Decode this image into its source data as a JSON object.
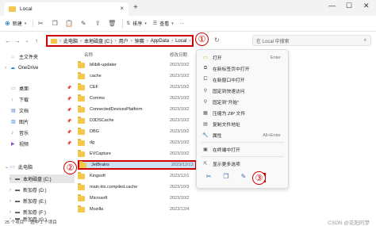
{
  "window": {
    "tab_title": "Local",
    "add_tab": "+",
    "close_tab": "×"
  },
  "toolbar": {
    "new_label": "新建",
    "sort_label": "排序",
    "view_label": "查看",
    "more_label": "···"
  },
  "address": {
    "crumbs": [
      "此电脑",
      "本地磁盘 (C:)",
      "用户",
      "钟赛",
      "AppData",
      "Local"
    ],
    "search_placeholder": "在 Local 中搜索"
  },
  "sidebar": {
    "items": [
      {
        "label": "主文件夹",
        "icon": "home-icon",
        "pinned": false
      },
      {
        "label": "OneDrive",
        "icon": "cloud-icon",
        "pinned": false
      },
      {
        "label": "桌面",
        "icon": "desktop-icon",
        "pinned": true
      },
      {
        "label": "下载",
        "icon": "download-icon",
        "pinned": true
      },
      {
        "label": "文档",
        "icon": "document-icon",
        "pinned": true
      },
      {
        "label": "图片",
        "icon": "picture-icon",
        "pinned": true
      },
      {
        "label": "音乐",
        "icon": "music-icon",
        "pinned": true
      },
      {
        "label": "视频",
        "icon": "video-icon",
        "pinned": true
      },
      {
        "label": "此电脑",
        "icon": "computer-icon",
        "pinned": false
      },
      {
        "label": "本地磁盘 (C:)",
        "icon": "drive-icon",
        "pinned": false
      },
      {
        "label": "新加卷 (D:)",
        "icon": "drive-icon",
        "pinned": false
      },
      {
        "label": "新加卷 (E:)",
        "icon": "drive-icon",
        "pinned": false
      },
      {
        "label": "新加卷 (F:)",
        "icon": "drive-icon",
        "pinned": false
      },
      {
        "label": "新加卷 (G:)",
        "icon": "drive-icon",
        "pinned": false
      }
    ]
  },
  "filelist": {
    "col_name": "名称",
    "col_date": "修改日期",
    "rows": [
      {
        "name": "bilibili-updater",
        "date": "2023/10/2"
      },
      {
        "name": "cache",
        "date": "2023/10/2"
      },
      {
        "name": "CEF",
        "date": "2023/10/2"
      },
      {
        "name": "Comms",
        "date": "2023/10/2"
      },
      {
        "name": "ConnectedDevicesPlatform",
        "date": "2023/10/2"
      },
      {
        "name": "D3DSCache",
        "date": "2023/10/2"
      },
      {
        "name": "DBG",
        "date": "2023/10/2"
      },
      {
        "name": "dg",
        "date": "2023/10/2"
      },
      {
        "name": "EVCapture",
        "date": "2023/10/2"
      },
      {
        "name": "JetBrains",
        "date": "2023/12/13",
        "selected": true
      },
      {
        "name": "Kingsoft",
        "date": "2023/12/1"
      },
      {
        "name": "main.kts.compiled.cache",
        "date": "2023/10/3"
      },
      {
        "name": "Microsoft",
        "date": "2023/10/2"
      },
      {
        "name": "Mozilla",
        "date": "2023/12/4"
      }
    ]
  },
  "context_menu": {
    "items": [
      {
        "label": "打开",
        "key": "Enter",
        "icon": "folder-open-icon"
      },
      {
        "label": "在新标签页中打开",
        "key": "",
        "icon": "new-tab-icon"
      },
      {
        "label": "在新窗口中打开",
        "key": "",
        "icon": "new-window-icon"
      },
      {
        "label": "固定到快速访问",
        "key": "",
        "icon": "pin-icon"
      },
      {
        "label": "固定到\"开始\"",
        "key": "",
        "icon": "pin-start-icon"
      },
      {
        "label": "压缩为 ZIP 文件",
        "key": "",
        "icon": "zip-icon"
      },
      {
        "label": "复制文件地址",
        "key": "",
        "icon": "copy-path-icon"
      },
      {
        "label": "属性",
        "key": "Alt+Enter",
        "icon": "properties-icon"
      },
      {
        "label": "在终端中打开",
        "key": "",
        "icon": "terminal-icon"
      },
      {
        "label": "显示更多选项",
        "key": "",
        "icon": "more-options-icon"
      }
    ]
  },
  "callouts": {
    "one": "①",
    "two": "②",
    "three": "③"
  },
  "status": {
    "count": "25 个项目",
    "selected": "选中 1 个项目"
  },
  "watermark": "CSDN @花阳的梦"
}
